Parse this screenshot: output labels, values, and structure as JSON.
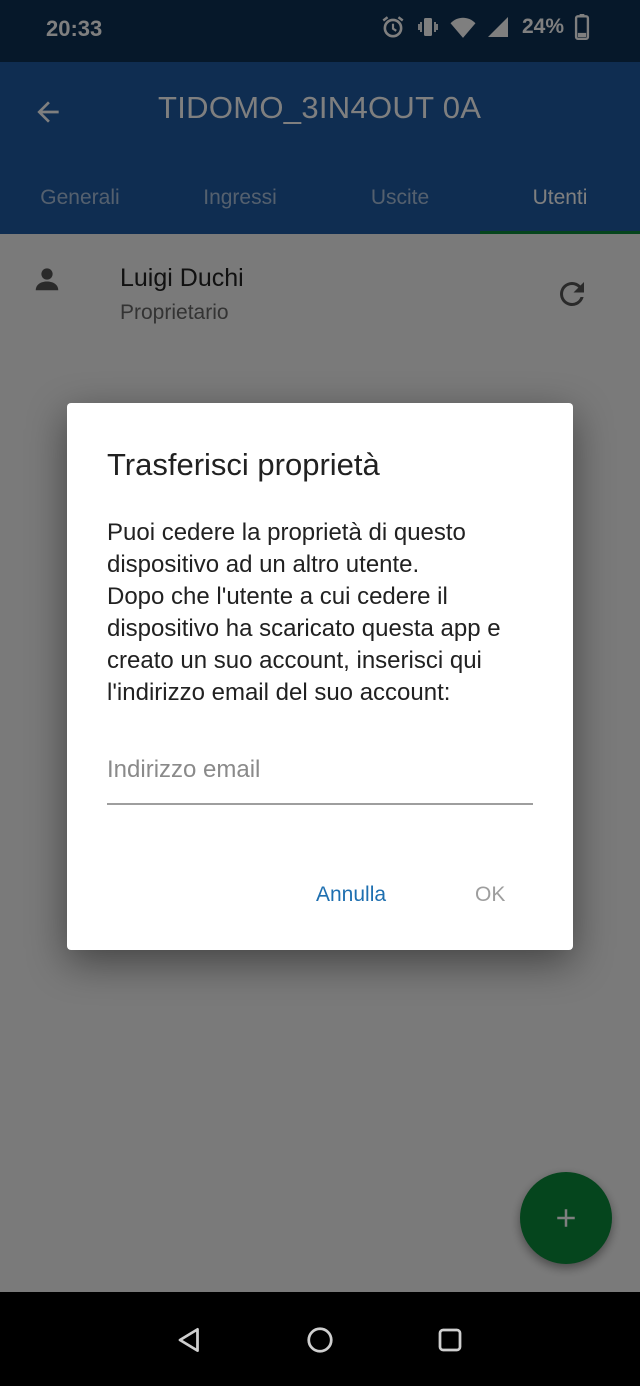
{
  "status_bar": {
    "time": "20:33",
    "battery": "24%",
    "icons": [
      "alarm-icon",
      "vibrate-icon",
      "wifi-icon",
      "signal-icon",
      "battery-icon"
    ]
  },
  "app_bar": {
    "title": "TIDOMO_3IN4OUT 0A",
    "tabs": [
      {
        "label": "Generali"
      },
      {
        "label": "Ingressi"
      },
      {
        "label": "Uscite"
      },
      {
        "label": "Utenti",
        "active": true
      }
    ]
  },
  "users": [
    {
      "name": "Luigi Duchi",
      "role": "Proprietario"
    }
  ],
  "dialog": {
    "title": "Trasferisci proprietà",
    "message": "Puoi cedere la proprietà di questo dispositivo ad un altro utente.\nDopo che l'utente a cui cedere il dispositivo ha scaricato questa app e creato un suo account, inserisci qui l'indirizzo email del suo account:",
    "email_value": "",
    "email_placeholder": "Indirizzo email",
    "cancel_label": "Annulla",
    "ok_label": "OK"
  },
  "colors": {
    "status_bar": "#0d3055",
    "app_bar": "#1e5aa3",
    "accent_green": "#0b8a3a",
    "button_blue": "#1e6fb0"
  }
}
